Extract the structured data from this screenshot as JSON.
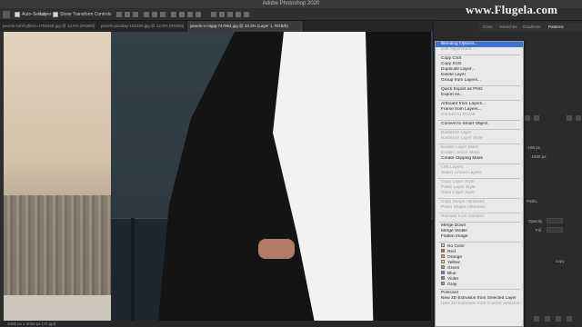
{
  "app": {
    "title": "Adobe Photoshop 2020"
  },
  "brand": {
    "text": "www.Flugela.com"
  },
  "options_bar": {
    "auto_select_label": "Auto-Select:",
    "auto_select_value": "Layer",
    "show_transform_label": "Show Transform Controls"
  },
  "doc_tabs": [
    {
      "label": "pexels-sohil-ghimo-1755365.jpg @ 12.5% (RGB/8)",
      "active": false
    },
    {
      "label": "pexels-pixabay-102220.jpg @ 12.5% (RGB/8)",
      "active": false
    },
    {
      "label": "pexels-s-migaj-747964.jpg @ 33.3% (Layer 1, RGB/8)",
      "active": true
    }
  ],
  "panel_tabs": [
    "Color",
    "Swatches",
    "Gradients",
    "Patterns"
  ],
  "panel_labels": {
    "paths": "Paths",
    "opacity": "Opacity",
    "fill": "Fill",
    "copy": "copy",
    "x_value": "-168 px",
    "y_value": "-1830 px"
  },
  "status": {
    "text": "4000 px x 2029 px (72 ppi)"
  },
  "menu": {
    "items": [
      {
        "label": "Blending Options...",
        "state": "highlighted"
      },
      {
        "label": "Edit Adjustment...",
        "state": "disabled"
      },
      {
        "sep": true
      },
      {
        "label": "Copy CSS",
        "state": "enabled"
      },
      {
        "label": "Copy SVG",
        "state": "enabled"
      },
      {
        "label": "Duplicate Layer...",
        "state": "enabled"
      },
      {
        "label": "Delete Layer",
        "state": "enabled"
      },
      {
        "label": "Group from Layers...",
        "state": "enabled"
      },
      {
        "sep": true
      },
      {
        "label": "Quick Export as PNG",
        "state": "enabled"
      },
      {
        "label": "Export As...",
        "state": "enabled"
      },
      {
        "sep": true
      },
      {
        "label": "Artboard from Layers...",
        "state": "enabled"
      },
      {
        "label": "Frame from Layers...",
        "state": "enabled"
      },
      {
        "label": "Convert to Frame",
        "state": "disabled"
      },
      {
        "sep": true
      },
      {
        "label": "Convert to Smart Object",
        "state": "enabled"
      },
      {
        "sep": true
      },
      {
        "label": "Rasterize Layer",
        "state": "disabled"
      },
      {
        "label": "Rasterize Layer Style",
        "state": "disabled"
      },
      {
        "sep": true
      },
      {
        "label": "Enable Layer Mask",
        "state": "disabled"
      },
      {
        "label": "Enable Vector Mask",
        "state": "disabled"
      },
      {
        "label": "Create Clipping Mask",
        "state": "enabled"
      },
      {
        "sep": true
      },
      {
        "label": "Link Layers",
        "state": "disabled"
      },
      {
        "label": "Select Linked Layers",
        "state": "disabled"
      },
      {
        "sep": true
      },
      {
        "label": "Copy Layer Style",
        "state": "disabled"
      },
      {
        "label": "Paste Layer Style",
        "state": "disabled"
      },
      {
        "label": "Clear Layer Style",
        "state": "disabled"
      },
      {
        "sep": true
      },
      {
        "label": "Copy Shape Attributes",
        "state": "disabled"
      },
      {
        "label": "Paste Shape Attributes",
        "state": "disabled"
      },
      {
        "sep": true
      },
      {
        "label": "Release from Isolation",
        "state": "disabled"
      },
      {
        "sep": true
      },
      {
        "label": "Merge Down",
        "state": "enabled"
      },
      {
        "label": "Merge Visible",
        "state": "enabled"
      },
      {
        "label": "Flatten Image",
        "state": "enabled"
      },
      {
        "sep": true
      },
      {
        "label": "No Color",
        "state": "enabled",
        "swatch": "#ffffff",
        "x": true
      },
      {
        "label": "Red",
        "state": "enabled",
        "swatch": "#d9534f"
      },
      {
        "label": "Orange",
        "state": "enabled",
        "swatch": "#f0a040"
      },
      {
        "label": "Yellow",
        "state": "enabled",
        "swatch": "#e8d84a"
      },
      {
        "label": "Green",
        "state": "enabled",
        "swatch": "#6cc04a"
      },
      {
        "label": "Blue",
        "state": "enabled",
        "swatch": "#5a8fd8"
      },
      {
        "label": "Violet",
        "state": "enabled",
        "swatch": "#9a6ad0"
      },
      {
        "label": "Gray",
        "state": "enabled",
        "swatch": "#9a9a9a"
      },
      {
        "sep": true
      },
      {
        "label": "Postcard",
        "state": "enabled"
      },
      {
        "label": "New 3D Extrusion from Selected Layer",
        "state": "enabled"
      },
      {
        "label": "New 3D Extrusion from Current Selection",
        "state": "disabled"
      }
    ]
  }
}
